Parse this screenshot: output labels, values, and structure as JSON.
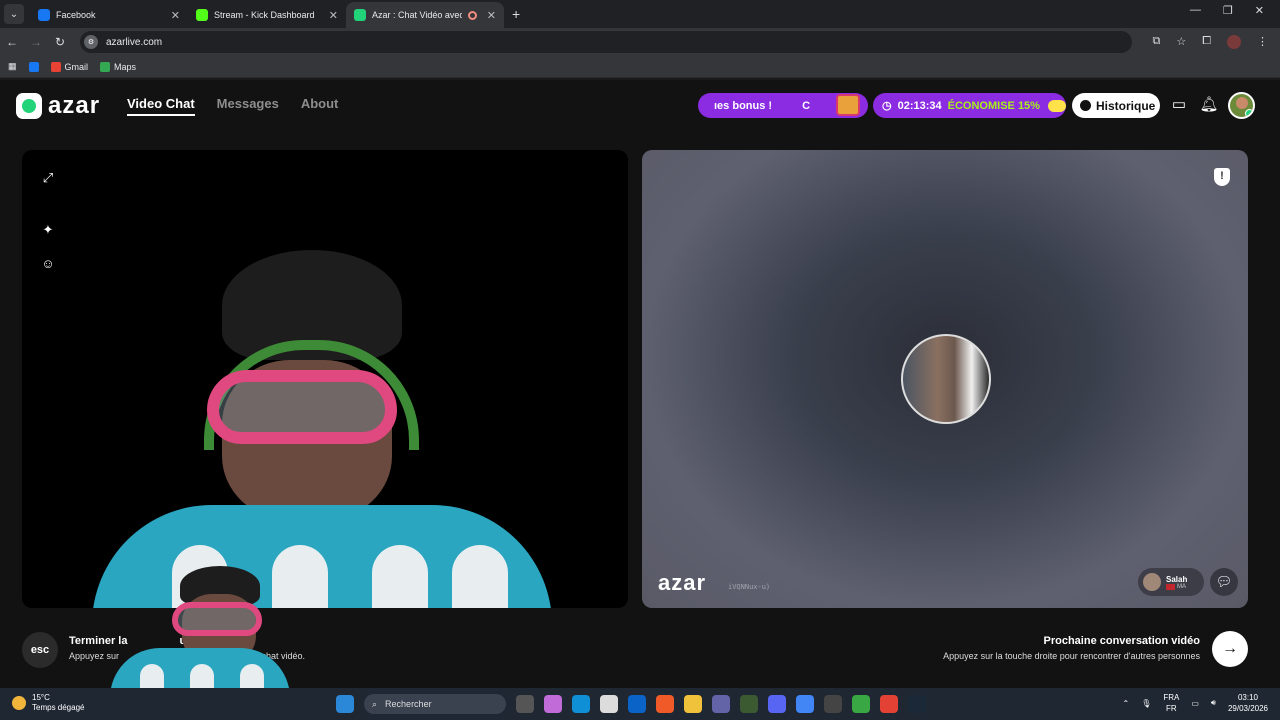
{
  "browser": {
    "tabs": [
      {
        "title": "Facebook",
        "color": "#1877f2"
      },
      {
        "title": "Stream - Kick Dashboard",
        "color": "#53fc18"
      },
      {
        "title": "Azar : Chat Vidéo avec de n",
        "color": "#22d37a"
      }
    ],
    "url": "azarlive.com",
    "bookmarks": [
      {
        "label": "Gmail",
        "color": "#ea4335"
      },
      {
        "label": "Maps",
        "color": "#34a853"
      }
    ]
  },
  "app": {
    "logo": "azar",
    "nav": [
      "Video Chat",
      "Messages",
      "About"
    ],
    "bonus_text": "ıes bonus !",
    "bonus_trailing": "C",
    "timer": "02:13:34",
    "economise": "ÉCONOMISE 15%",
    "history": "Historique"
  },
  "remote": {
    "watermark": "azar",
    "watermark_id": "iVQNNux-u)",
    "peer_name": "Salah",
    "peer_country": "MA"
  },
  "footer": {
    "esc_key": "esc",
    "end_title": "Terminer la",
    "end_title_tail": "us",
    "end_sub": "Appuyez sur",
    "end_sub_tail": "u chat vidéo.",
    "next_title": "Prochaine conversation vidéo",
    "next_sub": "Appuyez sur la touche droite pour rencontrer d'autres personnes"
  },
  "taskbar": {
    "temperature": "15°C",
    "weather": "Temps dégagé",
    "search": "Rechercher",
    "lang_top": "FRA",
    "lang_bottom": "FR",
    "time": "03:10",
    "date": "29/03/2026"
  },
  "colors": {
    "brand": "#22d37a",
    "promo": "#8b2be2",
    "accent_green": "#a9f01b"
  }
}
